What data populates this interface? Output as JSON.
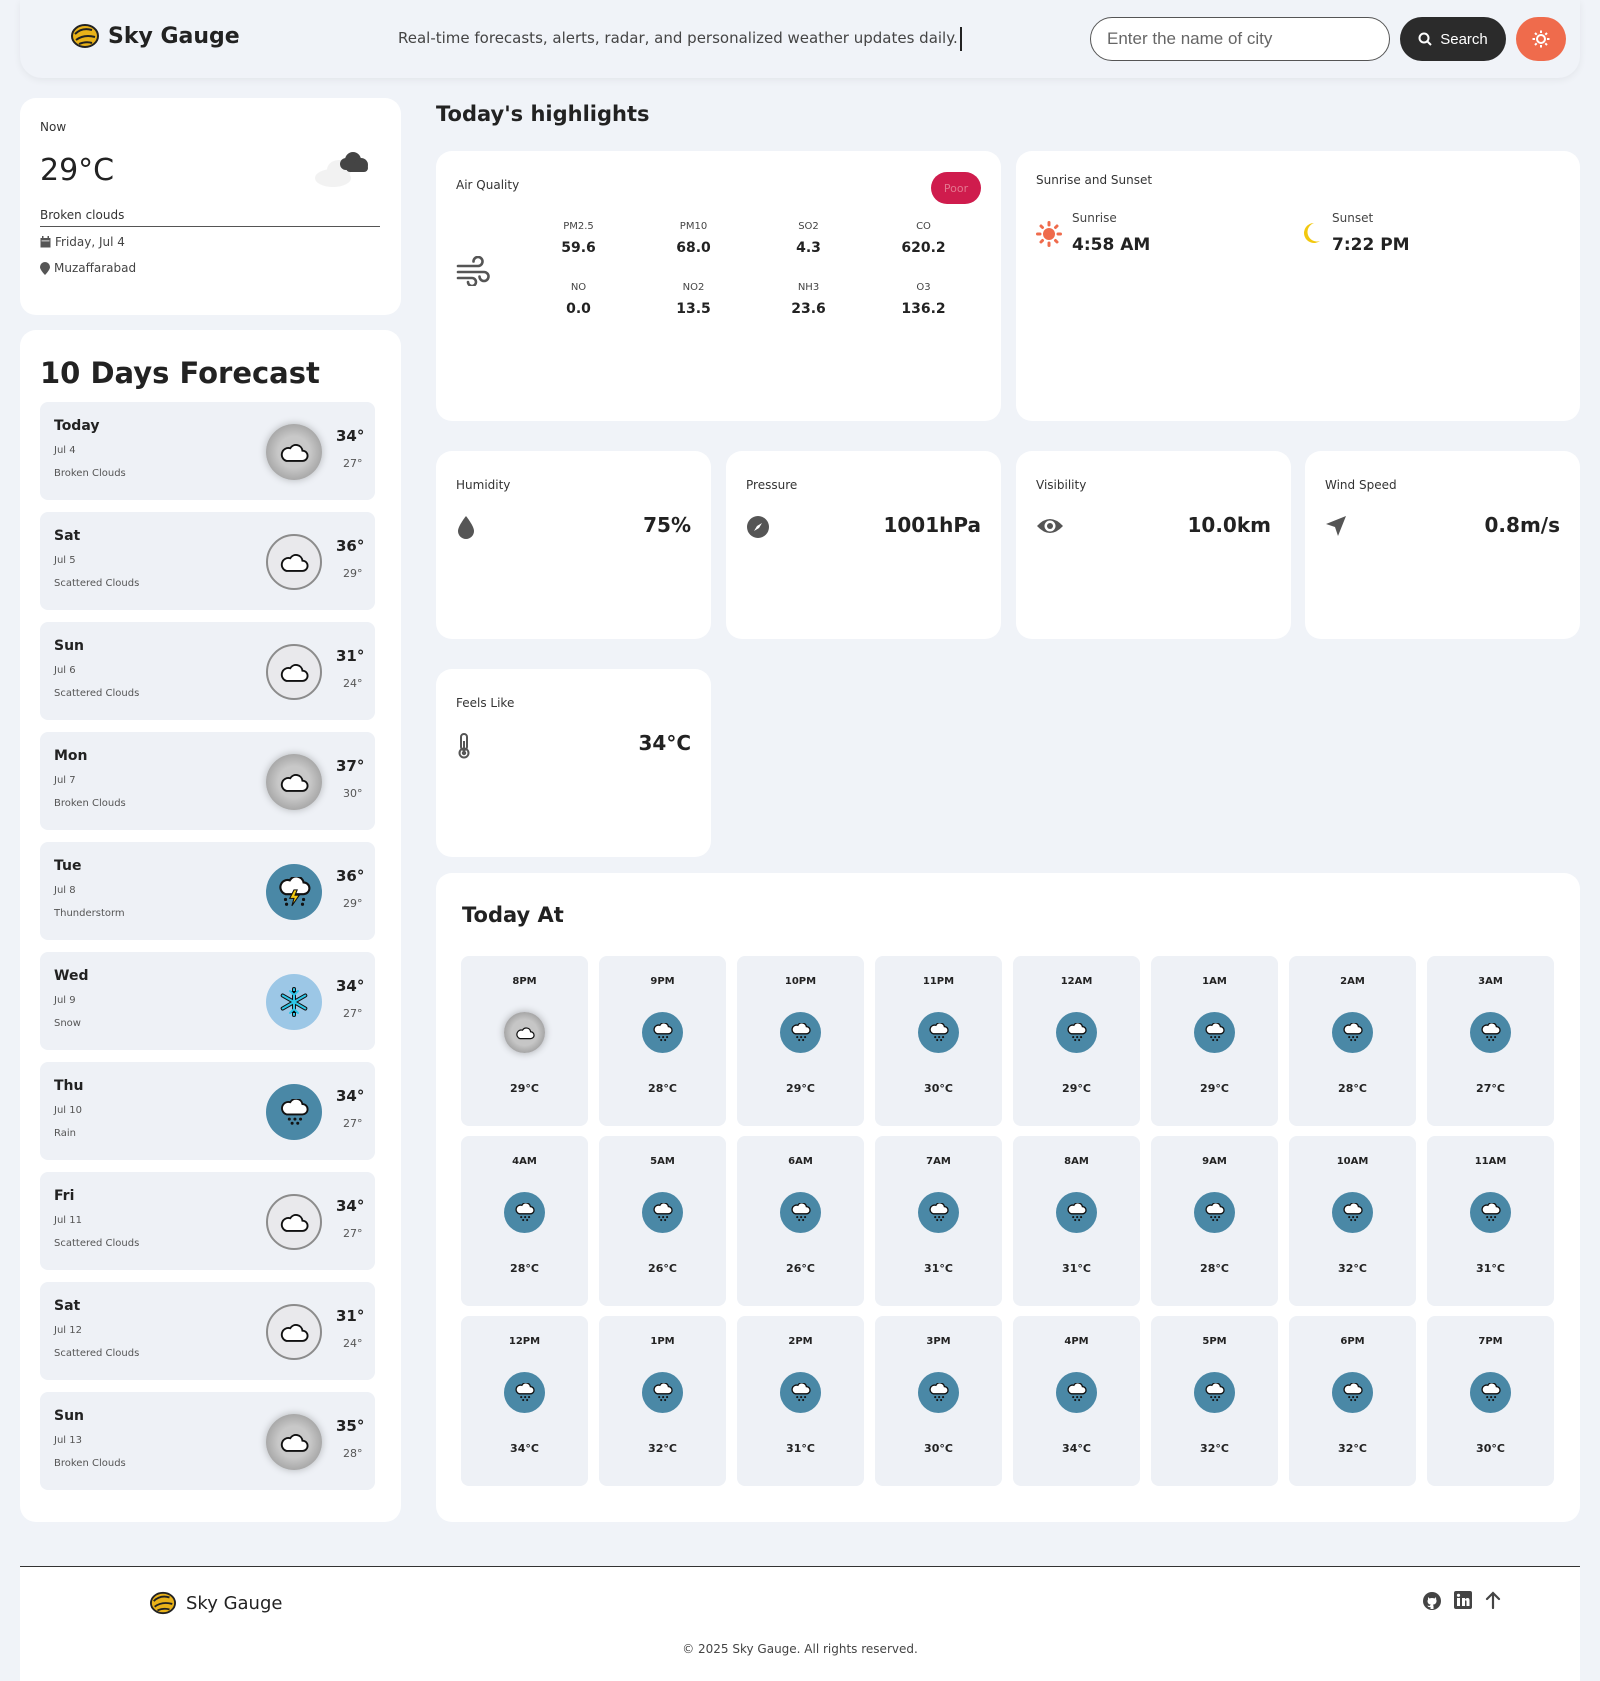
{
  "header": {
    "brand": "Sky Gauge",
    "tagline": "Real-time forecasts, alerts, radar, and personalized weather updates daily.",
    "search_placeholder": "Enter the name of city",
    "search_label": "Search"
  },
  "now": {
    "label": "Now",
    "temp": "29°C",
    "description": "Broken clouds",
    "date": "Friday, Jul 4",
    "location": "Muzaffarabad"
  },
  "forecast": {
    "title": "10 Days Forecast",
    "days": [
      {
        "day": "Today",
        "date": "Jul 4",
        "desc": "Broken Clouds",
        "high": "34°",
        "low": "27°",
        "icon": "broken-clouds"
      },
      {
        "day": "Sat",
        "date": "Jul 5",
        "desc": "Scattered Clouds",
        "high": "36°",
        "low": "29°",
        "icon": "scattered-clouds"
      },
      {
        "day": "Sun",
        "date": "Jul 6",
        "desc": "Scattered Clouds",
        "high": "31°",
        "low": "24°",
        "icon": "scattered-clouds"
      },
      {
        "day": "Mon",
        "date": "Jul 7",
        "desc": "Broken Clouds",
        "high": "37°",
        "low": "30°",
        "icon": "broken-clouds"
      },
      {
        "day": "Tue",
        "date": "Jul 8",
        "desc": "Thunderstorm",
        "high": "36°",
        "low": "29°",
        "icon": "thunderstorm"
      },
      {
        "day": "Wed",
        "date": "Jul 9",
        "desc": "Snow",
        "high": "34°",
        "low": "27°",
        "icon": "snow"
      },
      {
        "day": "Thu",
        "date": "Jul 10",
        "desc": "Rain",
        "high": "34°",
        "low": "27°",
        "icon": "rain"
      },
      {
        "day": "Fri",
        "date": "Jul 11",
        "desc": "Scattered Clouds",
        "high": "34°",
        "low": "27°",
        "icon": "scattered-clouds"
      },
      {
        "day": "Sat",
        "date": "Jul 12",
        "desc": "Scattered Clouds",
        "high": "31°",
        "low": "24°",
        "icon": "scattered-clouds"
      },
      {
        "day": "Sun",
        "date": "Jul 13",
        "desc": "Broken Clouds",
        "high": "35°",
        "low": "28°",
        "icon": "broken-clouds"
      }
    ]
  },
  "highlights": {
    "title": "Today's highlights",
    "air_quality": {
      "label": "Air Quality",
      "badge": "Poor",
      "badge_color": "#cf1c4d",
      "items": [
        {
          "name": "PM2.5",
          "value": "59.6"
        },
        {
          "name": "PM10",
          "value": "68.0"
        },
        {
          "name": "SO2",
          "value": "4.3"
        },
        {
          "name": "CO",
          "value": "620.2"
        },
        {
          "name": "NO",
          "value": "0.0"
        },
        {
          "name": "NO2",
          "value": "13.5"
        },
        {
          "name": "NH3",
          "value": "23.6"
        },
        {
          "name": "O3",
          "value": "136.2"
        }
      ]
    },
    "sun": {
      "label": "Sunrise and Sunset",
      "sunrise_label": "Sunrise",
      "sunrise": "4:58 AM",
      "sunset_label": "Sunset",
      "sunset": "7:22 PM"
    },
    "humidity": {
      "label": "Humidity",
      "value": "75%"
    },
    "pressure": {
      "label": "Pressure",
      "value": "1001hPa"
    },
    "visibility": {
      "label": "Visibility",
      "value": "10.0km"
    },
    "wind": {
      "label": "Wind Speed",
      "value": "0.8m/s"
    },
    "feels_like": {
      "label": "Feels Like",
      "value": "34°C"
    }
  },
  "today_at": {
    "title": "Today At",
    "hours": [
      {
        "time": "8PM",
        "temp": "29°C",
        "icon": "broken-clouds"
      },
      {
        "time": "9PM",
        "temp": "28°C",
        "icon": "rain"
      },
      {
        "time": "10PM",
        "temp": "29°C",
        "icon": "rain"
      },
      {
        "time": "11PM",
        "temp": "30°C",
        "icon": "rain"
      },
      {
        "time": "12AM",
        "temp": "29°C",
        "icon": "rain"
      },
      {
        "time": "1AM",
        "temp": "29°C",
        "icon": "rain"
      },
      {
        "time": "2AM",
        "temp": "28°C",
        "icon": "rain"
      },
      {
        "time": "3AM",
        "temp": "27°C",
        "icon": "rain"
      },
      {
        "time": "4AM",
        "temp": "28°C",
        "icon": "rain"
      },
      {
        "time": "5AM",
        "temp": "26°C",
        "icon": "rain"
      },
      {
        "time": "6AM",
        "temp": "26°C",
        "icon": "rain"
      },
      {
        "time": "7AM",
        "temp": "31°C",
        "icon": "rain"
      },
      {
        "time": "8AM",
        "temp": "31°C",
        "icon": "rain"
      },
      {
        "time": "9AM",
        "temp": "28°C",
        "icon": "rain"
      },
      {
        "time": "10AM",
        "temp": "32°C",
        "icon": "rain"
      },
      {
        "time": "11AM",
        "temp": "31°C",
        "icon": "rain"
      },
      {
        "time": "12PM",
        "temp": "34°C",
        "icon": "rain"
      },
      {
        "time": "1PM",
        "temp": "32°C",
        "icon": "rain"
      },
      {
        "time": "2PM",
        "temp": "31°C",
        "icon": "rain"
      },
      {
        "time": "3PM",
        "temp": "30°C",
        "icon": "rain"
      },
      {
        "time": "4PM",
        "temp": "34°C",
        "icon": "rain"
      },
      {
        "time": "5PM",
        "temp": "32°C",
        "icon": "rain"
      },
      {
        "time": "6PM",
        "temp": "32°C",
        "icon": "rain"
      },
      {
        "time": "7PM",
        "temp": "30°C",
        "icon": "rain"
      }
    ]
  },
  "footer": {
    "brand": "Sky Gauge",
    "copyright": "© 2025 Sky Gauge. All rights reserved.",
    "icons": [
      "github-icon",
      "linkedin-icon",
      "arrow-up-icon"
    ]
  },
  "colors": {
    "accent": "#ef6b4c",
    "rain_icon_bg": "#4a88a6",
    "page_bg": "#f0f3f8"
  }
}
